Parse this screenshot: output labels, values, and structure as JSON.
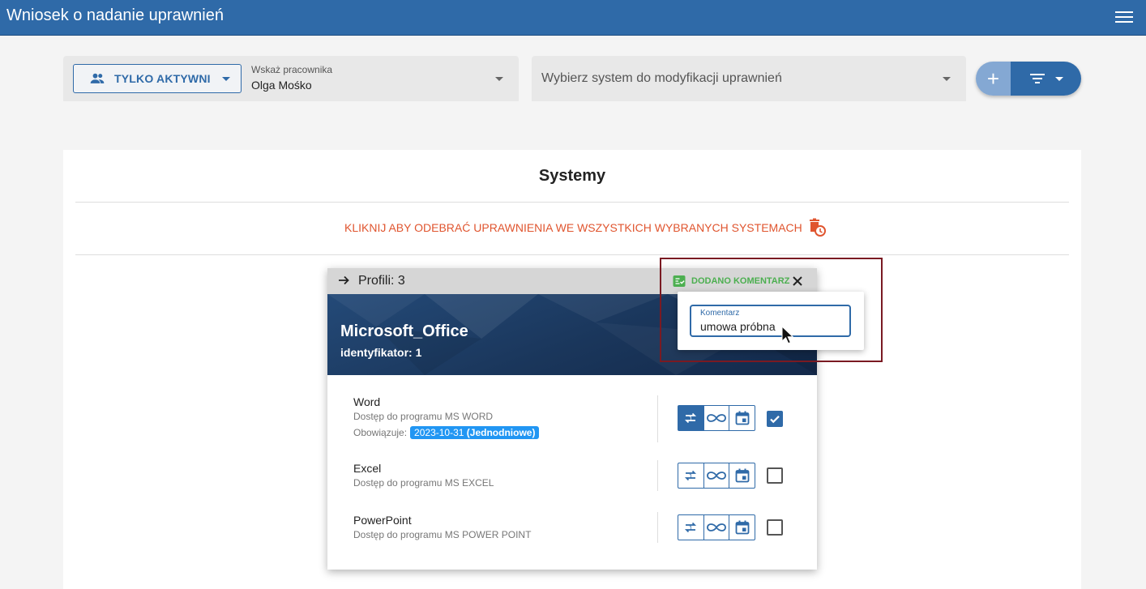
{
  "app": {
    "title": "Wniosek o nadanie uprawnień",
    "menu_icon": "hamburger-menu-icon"
  },
  "filter": {
    "toggle_label": "TYLKO AKTYWNI",
    "employee_label": "Wskaż pracownika",
    "employee_value": "Olga Mośko"
  },
  "system_select": {
    "placeholder": "Wybierz system do modyfikacji uprawnień"
  },
  "fab": {
    "add_icon": "+",
    "filter_icon": "filter-list-icon"
  },
  "card": {
    "heading": "Systemy",
    "revoke_text": "KLIKNIJ ABY ODEBRAĆ UPRAWNIENIA WE WSZYSTKICH WYBRANYCH SYSTEMACH"
  },
  "panel": {
    "profiles": "Profili: 3",
    "comment_added": "DODANO KOMENTARZ",
    "system_name": "Microsoft_Office",
    "identifier": "identyfikator: 1",
    "rows": [
      {
        "name": "Word",
        "desc": "Dostęp do programu MS WORD",
        "valid_label": "Obowiązuje:",
        "valid_date": "2023-10-31",
        "valid_type": "(Jednodniowe)",
        "checked": true
      },
      {
        "name": "Excel",
        "desc": "Dostęp do programu MS EXCEL",
        "checked": false
      },
      {
        "name": "PowerPoint",
        "desc": "Dostęp do programu MS POWER POINT",
        "checked": false
      }
    ]
  },
  "comment": {
    "label": "Komentarz",
    "value": "umowa próbna"
  },
  "colors": {
    "primary": "#2f6aa8",
    "danger": "#e0552f",
    "success": "#4caf50",
    "chip": "#2196f3"
  }
}
